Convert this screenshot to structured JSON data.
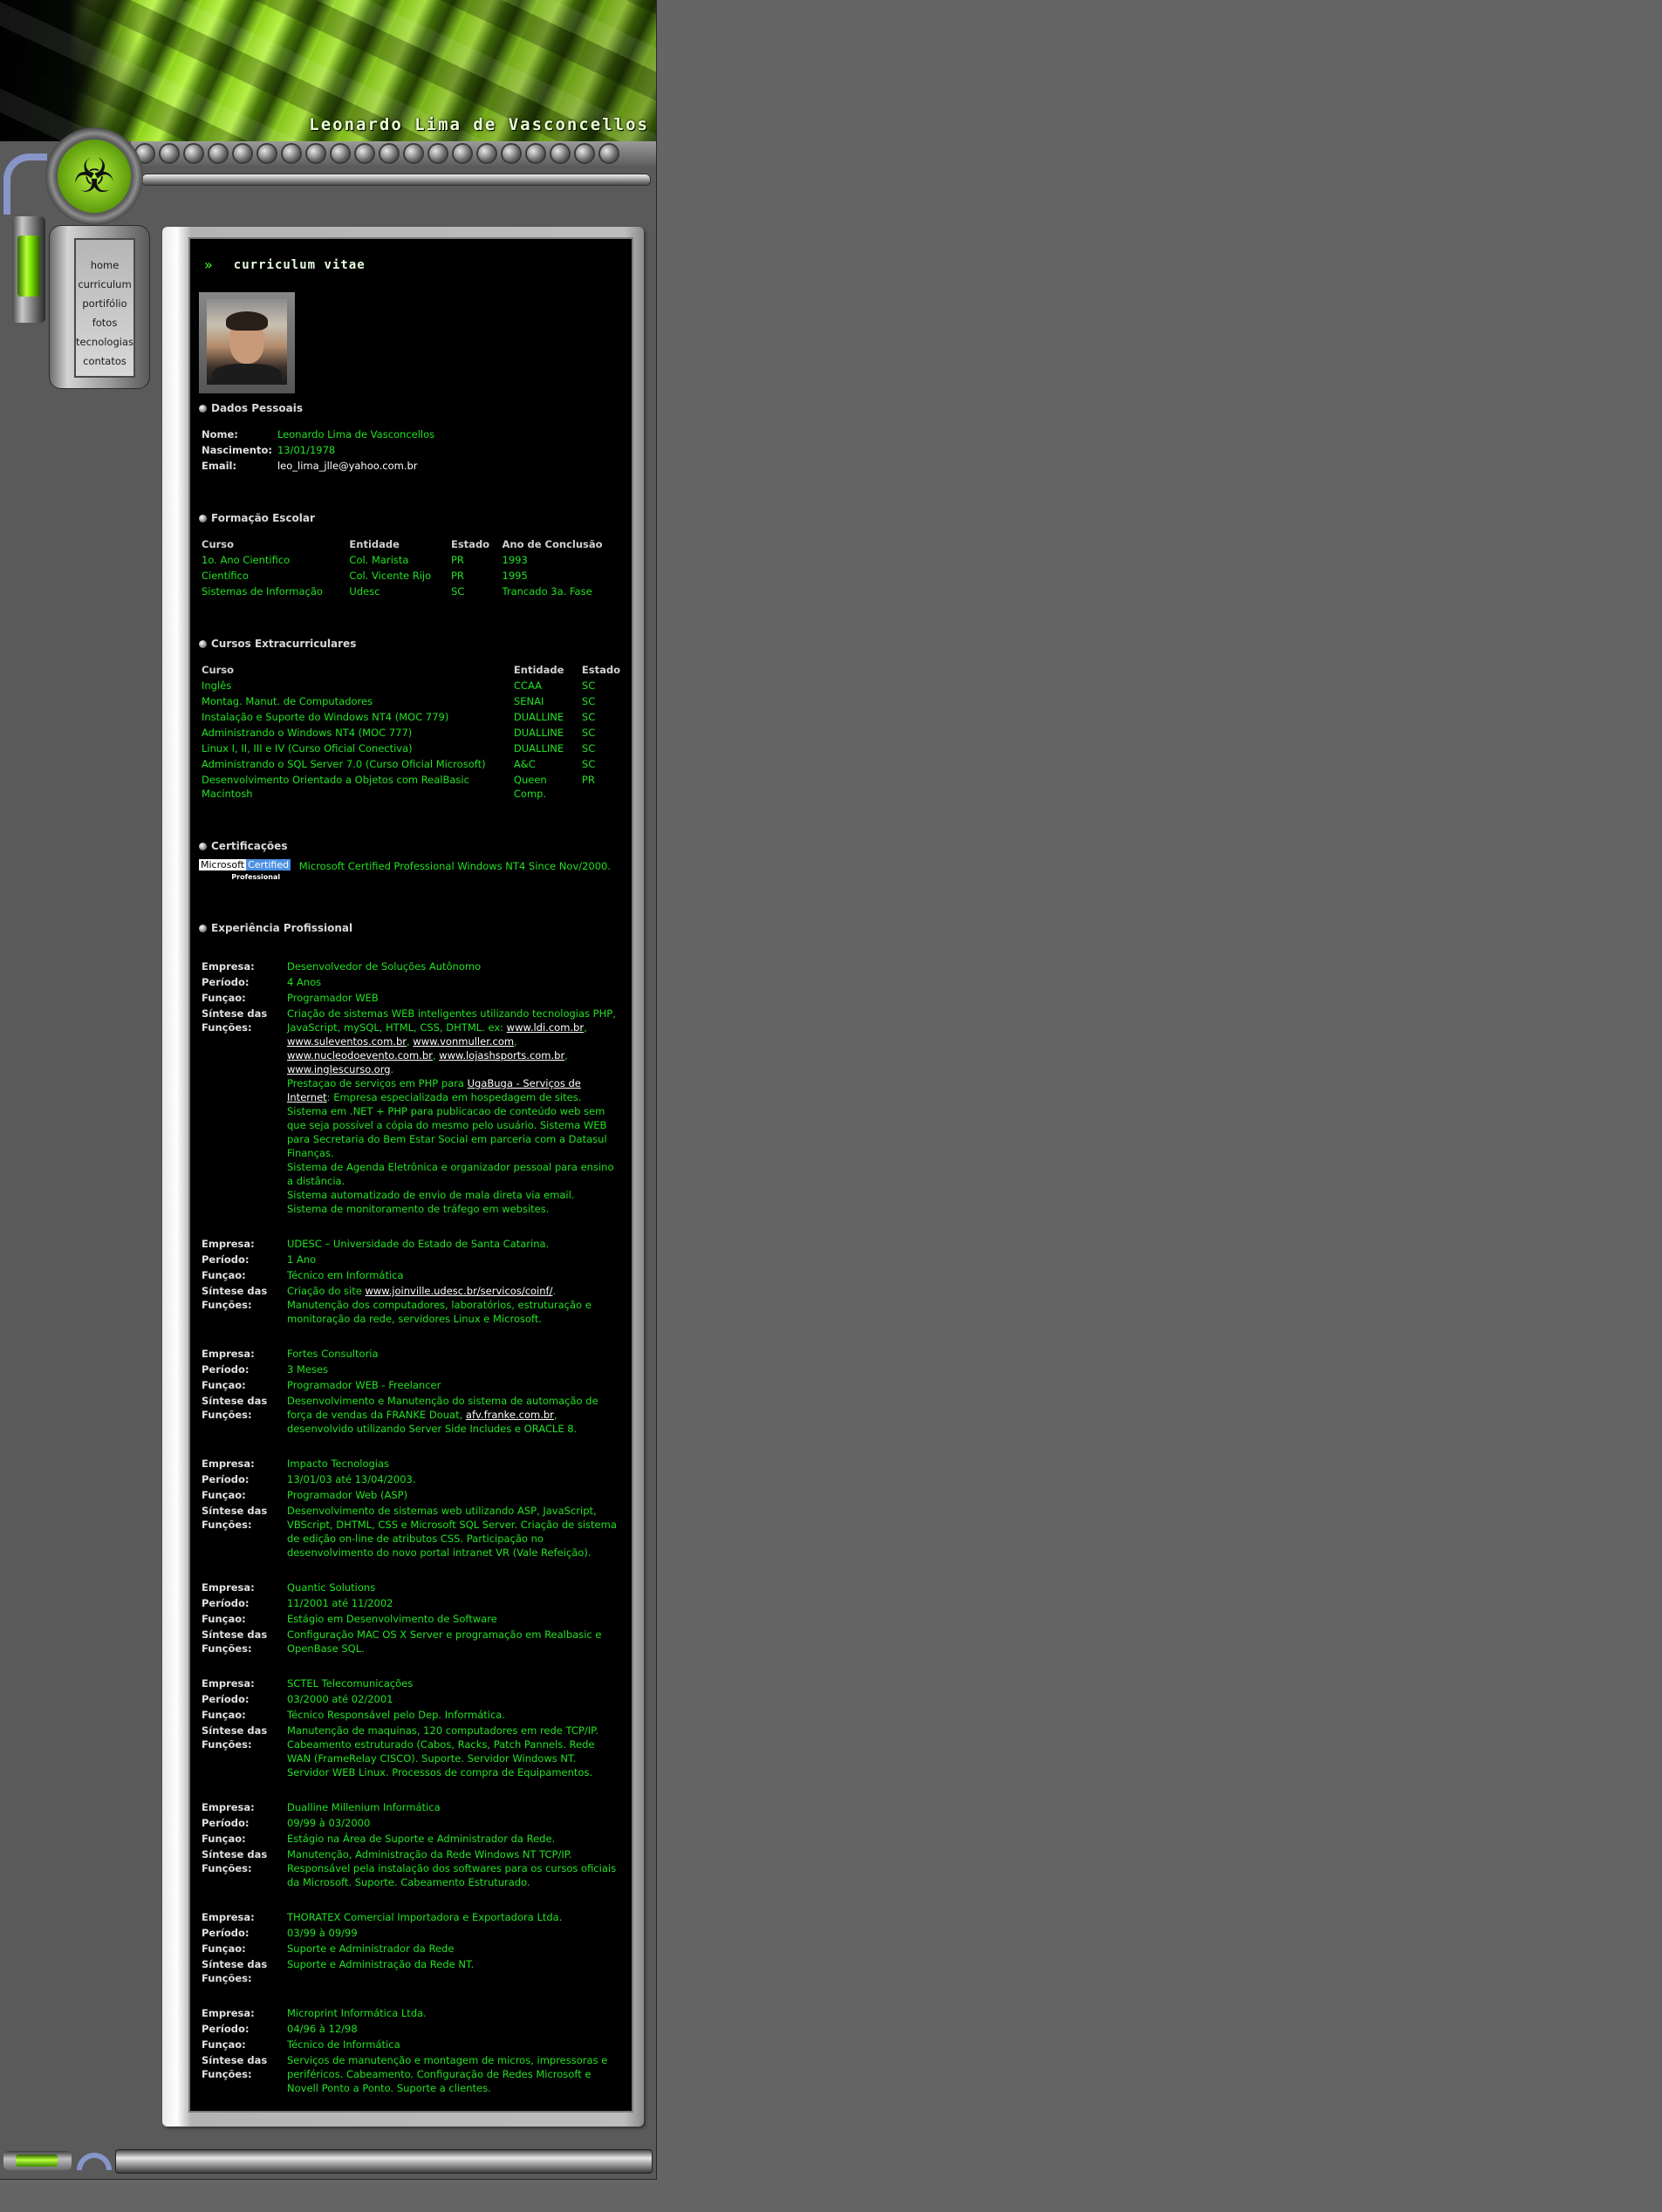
{
  "site": {
    "title": "Leonardo Lima de Vasconcellos"
  },
  "nav": {
    "items": [
      {
        "label": "home"
      },
      {
        "label": "curriculum"
      },
      {
        "label": "portifólio"
      },
      {
        "label": "fotos"
      },
      {
        "label": "tecnologias"
      },
      {
        "label": "contatos"
      }
    ]
  },
  "cv": {
    "title": "curriculum vitae"
  },
  "dados": {
    "heading": "Dados Pessoais",
    "nome_label": "Nome:",
    "nome": "Leonardo Lima de Vasconcellos",
    "nasc_label": "Nascimento:",
    "nasc": "13/01/1978",
    "email_label": "Email:",
    "email": "leo_lima_jlle@yahoo.com.br"
  },
  "formacao": {
    "heading": "Formação Escolar",
    "headers": [
      "Curso",
      "Entidade",
      "Estado",
      "Ano de Conclusão"
    ],
    "rows": [
      [
        "1o. Ano Cientifico",
        "Col. Marista",
        "PR",
        "1993"
      ],
      [
        "Científico",
        "Col. Vicente Rijo",
        "PR",
        "1995"
      ],
      [
        "Sistemas de Informação",
        "Udesc",
        "SC",
        "Trancado 3a. Fase"
      ]
    ]
  },
  "cursos": {
    "heading": "Cursos Extracurriculares",
    "headers": [
      "Curso",
      "Entidade",
      "Estado"
    ],
    "rows": [
      [
        "Inglês",
        "CCAA",
        "SC"
      ],
      [
        "Montag. Manut. de Computadores",
        "SENAI",
        "SC"
      ],
      [
        "Instalação e Suporte do Windows NT4 (MOC 779)",
        "DUALLINE",
        "SC"
      ],
      [
        "Administrando o Windows NT4 (MOC 777)",
        "DUALLINE",
        "SC"
      ],
      [
        "Linux I, II, III e IV (Curso Oficial Conectiva)",
        "DUALLINE",
        "SC"
      ],
      [
        "Administrando o SQL Server 7.0 (Curso Oficial Microsoft)",
        "A&C",
        "SC"
      ],
      [
        "Desenvolvimento Orientado a Objetos com RealBasic Macintosh",
        "Queen Comp.",
        "PR"
      ]
    ]
  },
  "cert": {
    "heading": "Certificações",
    "logo_ms": "Microsoft",
    "logo_cert": "Certified",
    "logo_pro": "Professional",
    "text": "Microsoft Certified Professional Windows NT4 Since Nov/2000."
  },
  "exp": {
    "heading": "Experiência Profissional",
    "labels": {
      "empresa": "Empresa:",
      "periodo": "Período:",
      "funcao": "Funçao:",
      "sintese": "Síntese das Funções:"
    },
    "job1": {
      "empresa": "Desenvolvedor de Soluções Autônomo",
      "periodo": "4 Anos",
      "funcao": "Programador WEB",
      "s1": "Criação de sistemas WEB inteligentes utilizando tecnologias PHP, JavaScript, mySQL, HTML, CSS, DHTML. ex:",
      "l1": "www.ldi.com.br",
      "l2": "www.suleventos.com.br",
      "l3": "www.vonmuller.com",
      "l4": "www.nucleodoevento.com.br",
      "l5": "www.lojashsports.com.br",
      "l6": "www.inglescurso.org",
      "s2": "Prestaçao de serviços em PHP para",
      "l7": "UgaBuga - Serviços de Internet",
      "s3": ": Empresa especializada em hospedagem de sites.",
      "s4": "Sistema em .NET + PHP para publicacao de conteúdo web sem que seja possível a cópia do mesmo pelo usuário. Sistema WEB para Secretaria do Bem Estar Social em parceria com a Datasul Finanças.",
      "s5": "Sistema de Agenda Eletrônica e organizador pessoal para ensino a distância.",
      "s6": "Sistema automatizado de envio de mala direta via email.",
      "s7": "Sistema de monitoramento de tráfego em websites."
    },
    "job2": {
      "empresa": "UDESC – Universidade do Estado de Santa Catarina.",
      "periodo": "1 Ano",
      "funcao": "Técnico em Informática",
      "s1": "Criação do site",
      "l1": "www.joinville.udesc.br/servicos/coinf/",
      "s2": ". Manutenção dos computadores, laboratórios, estruturação e monitoração da rede, servidores Linux e Microsoft."
    },
    "job3": {
      "empresa": "Fortes Consultoria",
      "periodo": "3 Meses",
      "funcao": "Programador WEB - Freelancer",
      "s1": "Desenvolvimento e Manutenção do sistema de automação de força de vendas da FRANKE Douat,",
      "l1": "afv.franke.com.br",
      "s2": ", desenvolvido utilizando Server Side Includes e ORACLE 8."
    },
    "job4": {
      "empresa": "Impacto Tecnologias",
      "periodo": "13/01/03 até 13/04/2003.",
      "funcao": "Programador Web (ASP)",
      "sintese": "Desenvolvimento de sistemas web utilizando ASP, JavaScript, VBScript, DHTML, CSS e Microsoft SQL Server. Criação de sistema de edição on-line de atributos CSS. Participação no desenvolvimento do novo portal intranet VR (Vale Refeição)."
    },
    "job5": {
      "empresa": "Quantic Solutions",
      "periodo": "11/2001 até 11/2002",
      "funcao": "Estágio em Desenvolvimento de Software",
      "sintese": "Configuração MAC OS X Server e programação em Realbasic e OpenBase SQL."
    },
    "job6": {
      "empresa": "SCTEL Telecomunicações",
      "periodo": "03/2000 até 02/2001",
      "funcao": "Técnico Responsável pelo Dep. Informática.",
      "sintese": "Manutenção de maquinas, 120 computadores em rede TCP/IP. Cabeamento estruturado (Cabos, Racks, Patch Pannels. Rede WAN (FrameRelay CISCO). Suporte. Servidor Windows NT. Servidor WEB Linux. Processos de compra de Equipamentos."
    },
    "job7": {
      "empresa": "Dualline Millenium Informática",
      "periodo": "09/99 à 03/2000",
      "funcao": "Estágio na Área de Suporte e Administrador da Rede.",
      "sintese": "Manutenção, Administração da Rede Windows NT TCP/IP. Responsável pela instalação dos softwares para os cursos oficiais da Microsoft. Suporte. Cabeamento Estruturado."
    },
    "job8": {
      "empresa": "THORATEX Comercial Importadora e Exportadora Ltda.",
      "periodo": "03/99 à 09/99",
      "funcao": "Suporte e Administrador da Rede",
      "sintese": "Suporte e Administração da Rede NT."
    },
    "job9": {
      "empresa": "Microprint Informática Ltda.",
      "periodo": "04/96 à 12/98",
      "funcao": "Técnico de Informática",
      "sintese": "Serviços de manutenção e montagem de micros, impressoras e periféricos. Cabeamento. Configuração de Redes Microsoft e Novell Ponto a Ponto. Suporte a clientes."
    }
  },
  "icons": {
    "biohazard": "biohazard-icon",
    "arrow": "double-chevron-right-icon",
    "bullet": "sphere-bullet-icon"
  },
  "colors": {
    "text_green": "#22e022",
    "background": "#656565",
    "content_bg": "#000000"
  }
}
